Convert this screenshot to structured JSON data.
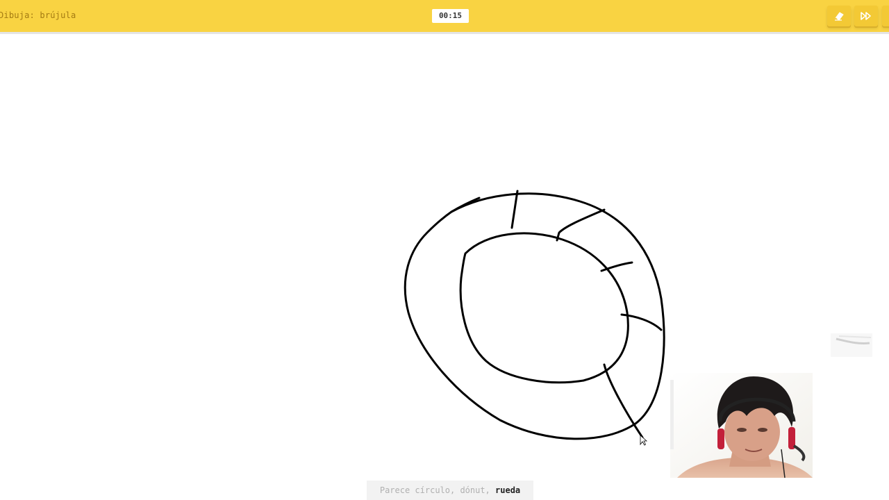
{
  "header": {
    "prompt_text": "Dibuja: brújula",
    "timer": "00:15",
    "clear_icon": "eraser-icon",
    "skip_icon": "fast-forward-icon"
  },
  "guess": {
    "prefix": "Parece círculo, dónut, ",
    "top_guess": "rueda"
  },
  "colors": {
    "header_bg": "#f9d342",
    "button_bg": "#f3c935",
    "ink": "#000000",
    "guess_bg": "#f2f2f2"
  }
}
